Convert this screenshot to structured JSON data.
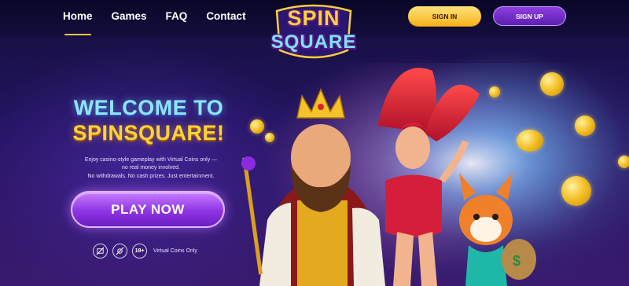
{
  "nav": {
    "items": [
      {
        "label": "Home",
        "active": true
      },
      {
        "label": "Games",
        "active": false
      },
      {
        "label": "FAQ",
        "active": false
      },
      {
        "label": "Contact",
        "active": false
      }
    ]
  },
  "logo": {
    "line1": "SPIN",
    "line2": "SQUARE"
  },
  "header": {
    "signin_label": "SIGN IN",
    "signup_label": "SIGN UP"
  },
  "hero": {
    "title_line1": "WELCOME TO",
    "title_line2": "SPINSQUARE!",
    "text_line1": "Enjoy casino-style gameplay with Virtual Coins only —",
    "text_line2": "no real money involved.",
    "text_line3": "No withdrawals. No cash prizes. Just entertainment.",
    "play_label": "PLAY NOW"
  },
  "badges": {
    "icons": [
      "no-money-icon",
      "no-cash-icon",
      "age-18-icon"
    ],
    "age_label": "18+",
    "label": "Virtual Coins Only"
  },
  "colors": {
    "accent_gold": "#f6c744",
    "accent_purple": "#8f34e4",
    "background": "#1a0f4a"
  }
}
